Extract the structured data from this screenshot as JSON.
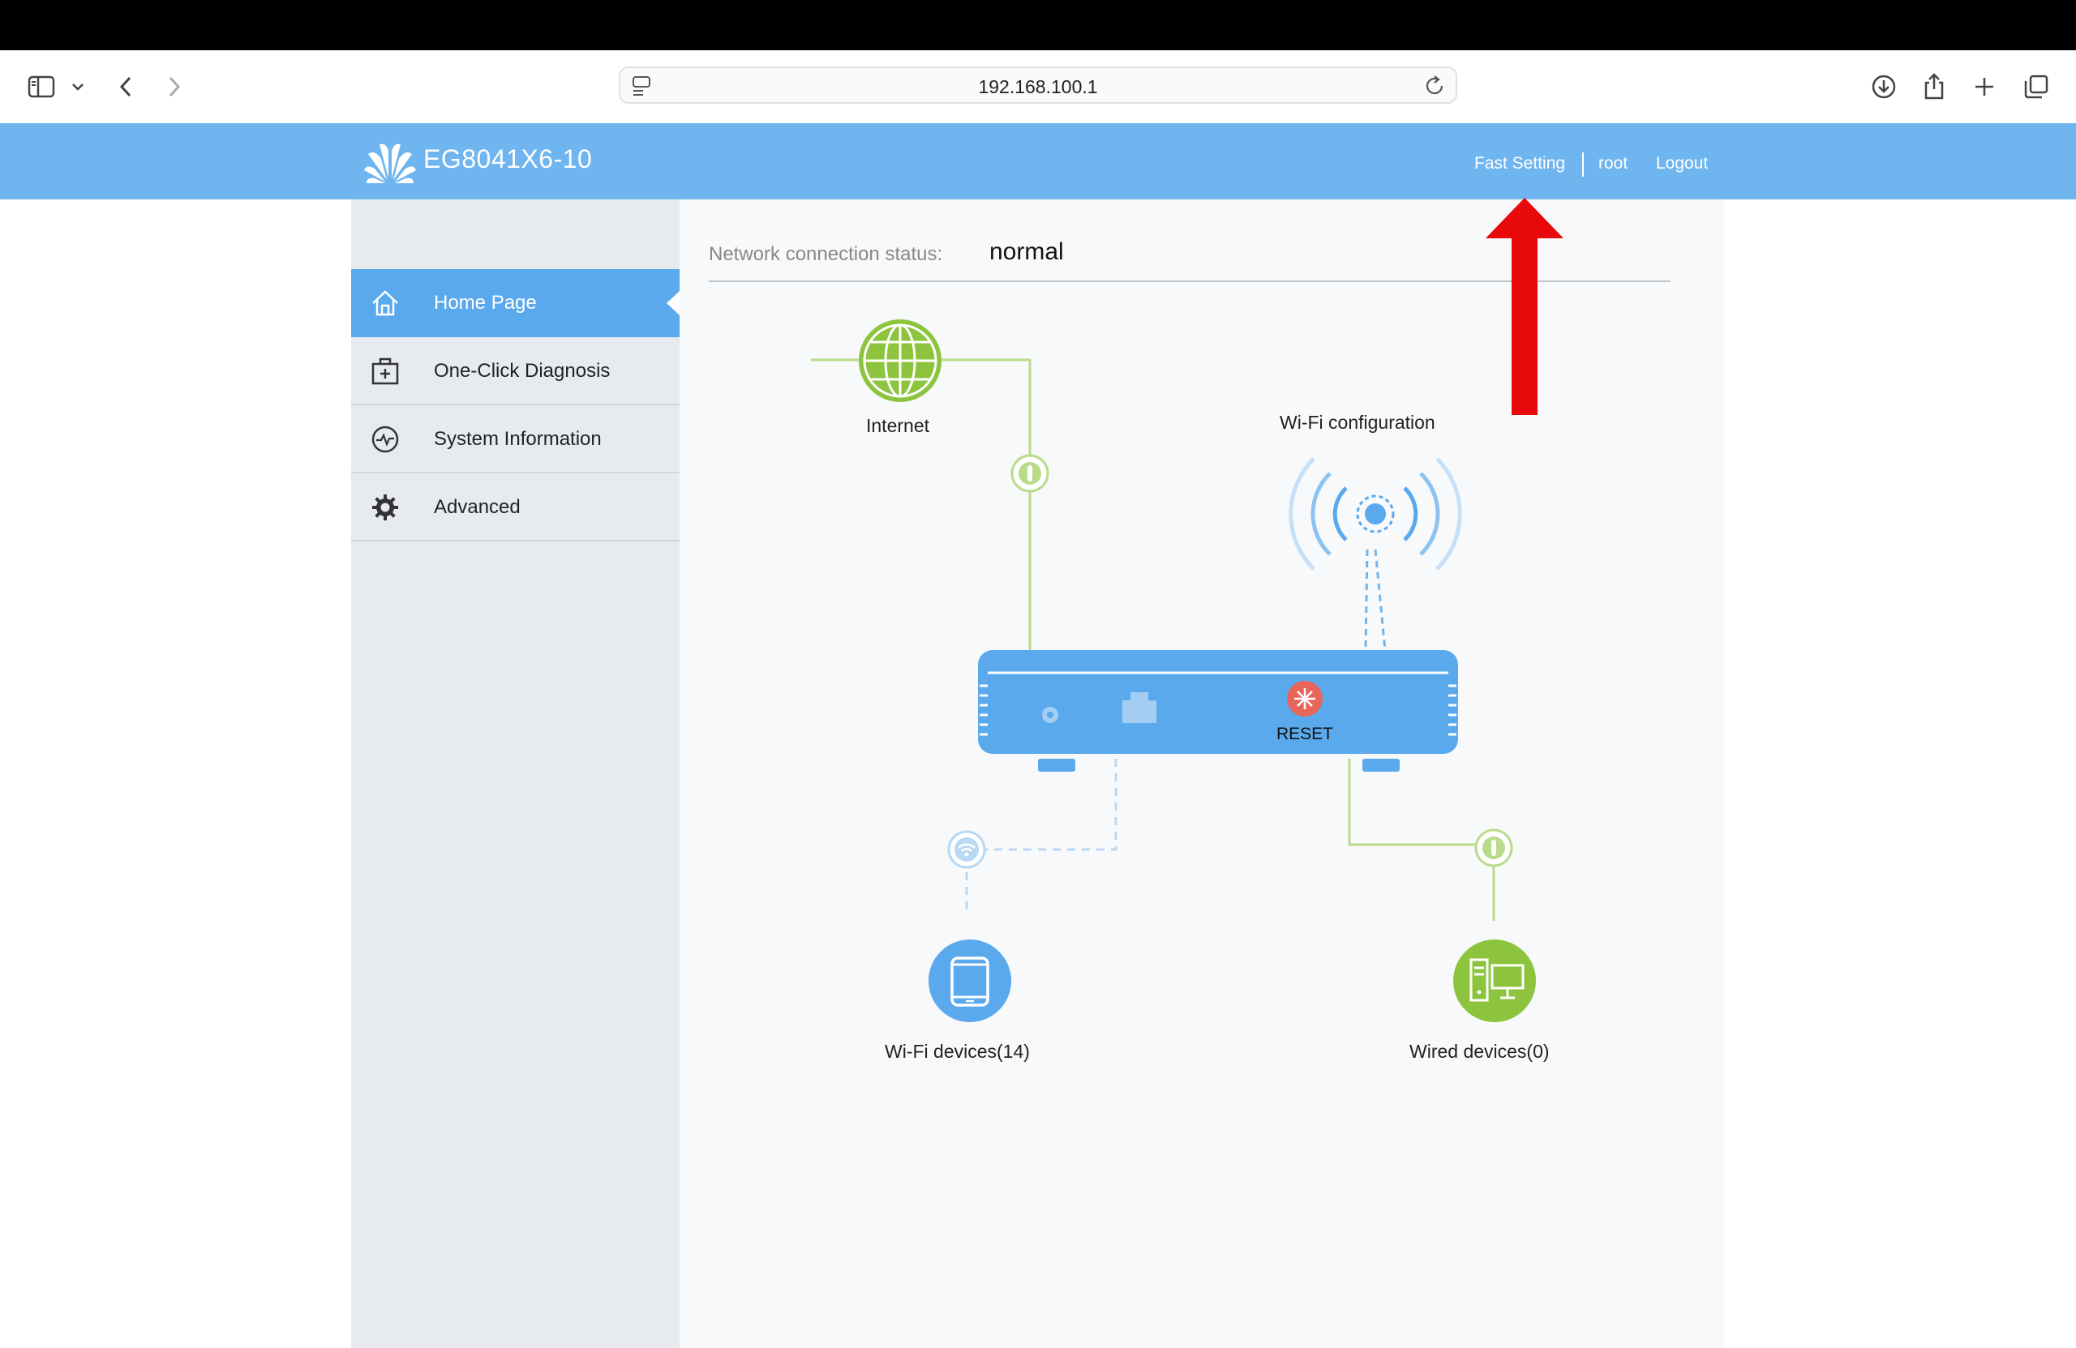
{
  "browser": {
    "url": "192.168.100.1"
  },
  "header": {
    "model": "EG8041X6-10",
    "fast_setting": "Fast Setting",
    "user": "root",
    "logout": "Logout"
  },
  "sidebar": {
    "items": [
      {
        "label": "Home Page",
        "icon": "home-icon",
        "active": true
      },
      {
        "label": "One-Click Diagnosis",
        "icon": "first-aid-kit-icon",
        "active": false
      },
      {
        "label": "System Information",
        "icon": "pulse-icon",
        "active": false
      },
      {
        "label": "Advanced",
        "icon": "gear-icon",
        "active": false
      }
    ]
  },
  "main": {
    "status_label": "Network connection status:",
    "status_value": "normal",
    "internet_label": "Internet",
    "wifi_config_label": "Wi-Fi configuration",
    "reset_label": "RESET",
    "wifi_devices_label": "Wi-Fi devices(14)",
    "wired_devices_label": "Wired devices(0)"
  },
  "colors": {
    "header_blue": "#6fb5ef",
    "active_blue": "#5aa9ec",
    "device_green": "#8cc43e",
    "device_blue": "#5aa9ec",
    "reset_red": "#e8655a",
    "annotation_red": "#e80a0a"
  }
}
